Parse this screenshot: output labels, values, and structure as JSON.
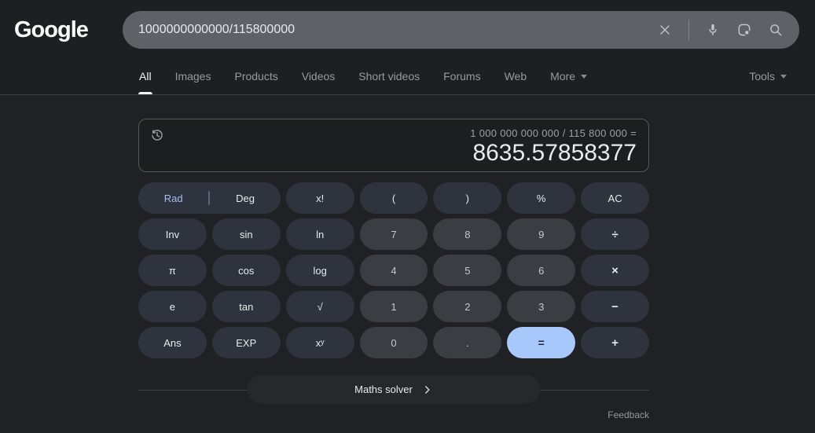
{
  "header": {
    "logo_text": "Google",
    "search": {
      "query": "1000000000000/115800000",
      "icons": [
        "clear-icon",
        "microphone-icon",
        "google-lens-icon",
        "search-icon"
      ]
    },
    "tabs": [
      {
        "label": "All",
        "active": true
      },
      {
        "label": "Images",
        "active": false
      },
      {
        "label": "Products",
        "active": false
      },
      {
        "label": "Videos",
        "active": false
      },
      {
        "label": "Short videos",
        "active": false
      },
      {
        "label": "Forums",
        "active": false
      },
      {
        "label": "Web",
        "active": false
      },
      {
        "label": "More",
        "active": false,
        "has_caret": true
      }
    ],
    "tools_label": "Tools"
  },
  "calculator": {
    "expression": "1 000 000 000 000 / 115 800 000 =",
    "result": "8635.57858377",
    "keypad": {
      "rad": "Rad",
      "deg": "Deg",
      "row1": [
        "x!",
        "(",
        ")",
        "%",
        "AC"
      ],
      "row2": [
        "Inv",
        "sin",
        "ln",
        "7",
        "8",
        "9",
        "÷"
      ],
      "row3": [
        "π",
        "cos",
        "log",
        "4",
        "5",
        "6",
        "×"
      ],
      "row4": [
        "e",
        "tan",
        "√",
        "1",
        "2",
        "3",
        "−"
      ],
      "row5": [
        "Ans",
        "EXP",
        "xʸ",
        "0",
        ".",
        "=",
        "+"
      ]
    }
  },
  "footer": {
    "math_solver_label": "Maths solver",
    "feedback_label": "Feedback"
  },
  "colors": {
    "background": "#202124",
    "searchbar_bg": "#5e6266",
    "key_function_bg": "#2e333e",
    "key_number_bg": "#3a3d42",
    "equals_bg": "#a8c7fa",
    "rad_active_text": "#a2bdee",
    "muted_text": "#9aa0a6"
  }
}
